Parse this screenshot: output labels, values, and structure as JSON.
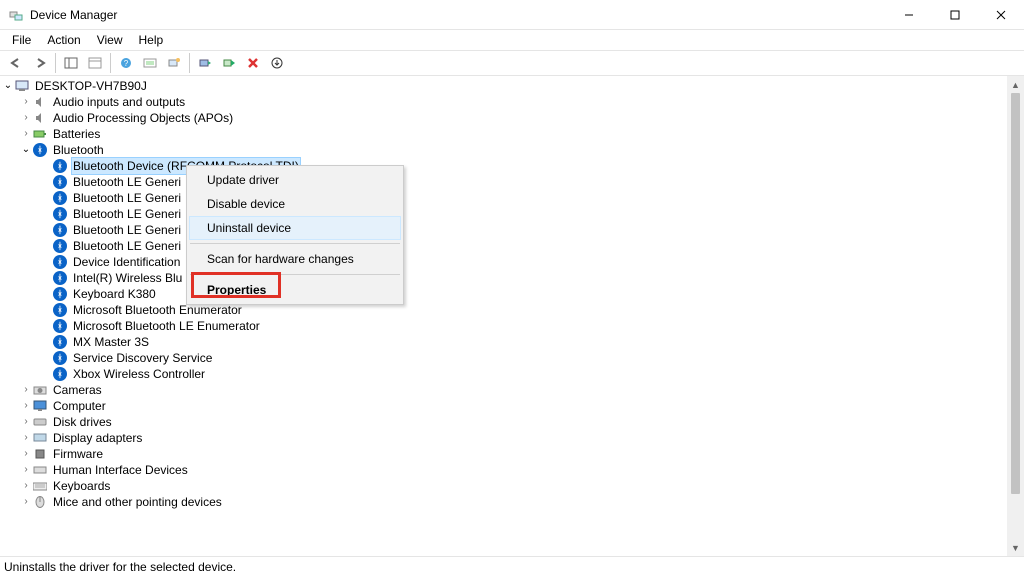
{
  "window_title": "Device Manager",
  "menus": {
    "file": "File",
    "action": "Action",
    "view": "View",
    "help": "Help"
  },
  "status_text": "Uninstalls the driver for the selected device.",
  "root_node": "DESKTOP-VH7B90J",
  "categories": {
    "audio_io": "Audio inputs and outputs",
    "apo": "Audio Processing Objects (APOs)",
    "batteries": "Batteries",
    "bluetooth": "Bluetooth",
    "cameras": "Cameras",
    "computer": "Computer",
    "disk": "Disk drives",
    "display": "Display adapters",
    "firmware": "Firmware",
    "hid": "Human Interface Devices",
    "keyboards": "Keyboards",
    "mice": "Mice and other pointing devices"
  },
  "bluetooth_items": [
    "Bluetooth Device (RFCOMM Protocol TDI)",
    "Bluetooth LE Generic Attribute Service",
    "Bluetooth LE Generic Attribute Service",
    "Bluetooth LE Generic Attribute Service",
    "Bluetooth LE Generic Attribute Service",
    "Bluetooth LE Generic Attribute Service",
    "Device Identification Service",
    "Intel(R) Wireless Bluetooth(R)",
    "Keyboard K380",
    "Microsoft Bluetooth Enumerator",
    "Microsoft Bluetooth LE Enumerator",
    "MX Master 3S",
    "Service Discovery Service",
    "Xbox Wireless Controller"
  ],
  "context_menu": {
    "update": "Update driver",
    "disable": "Disable device",
    "uninstall": "Uninstall device",
    "scan": "Scan for hardware changes",
    "properties": "Properties"
  }
}
